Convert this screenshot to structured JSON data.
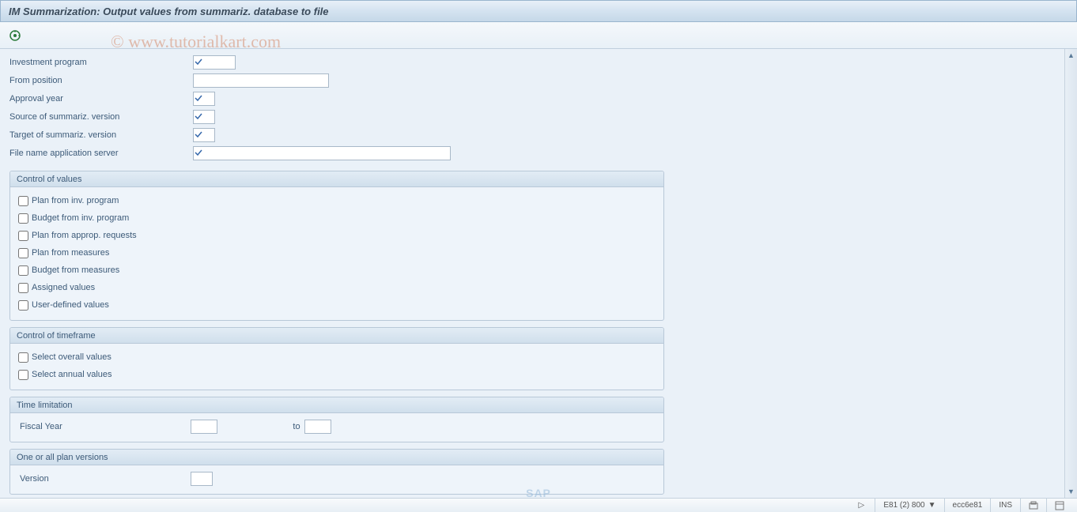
{
  "title": "IM Summarization: Output values from summariz. database to file",
  "watermark": "© www.tutorialkart.com",
  "header_fields": {
    "investment_program": {
      "label": "Investment program",
      "value": "",
      "required": true
    },
    "from_position": {
      "label": "From position",
      "value": "",
      "required": false
    },
    "approval_year": {
      "label": "Approval year",
      "value": "",
      "required": true
    },
    "source_version": {
      "label": "Source of summariz. version",
      "value": "",
      "required": true
    },
    "target_version": {
      "label": "Target of summariz. version",
      "value": "",
      "required": true
    },
    "file_name": {
      "label": "File name application server",
      "value": "",
      "required": true
    }
  },
  "groups": {
    "control_values": {
      "title": "Control of values",
      "items": [
        {
          "label": "Plan from inv. program",
          "checked": false
        },
        {
          "label": "Budget from inv. program",
          "checked": false
        },
        {
          "label": "Plan from approp. requests",
          "checked": false
        },
        {
          "label": "Plan from measures",
          "checked": false
        },
        {
          "label": "Budget from measures",
          "checked": false
        },
        {
          "label": "Assigned values",
          "checked": false
        },
        {
          "label": "User-defined values",
          "checked": false
        }
      ]
    },
    "control_timeframe": {
      "title": "Control of timeframe",
      "items": [
        {
          "label": "Select overall values",
          "checked": false
        },
        {
          "label": "Select annual values",
          "checked": false
        }
      ]
    },
    "time_limitation": {
      "title": "Time limitation",
      "fiscal_year_label": "Fiscal Year",
      "to_label": "to",
      "from": "",
      "to": ""
    },
    "plan_versions": {
      "title": "One or all plan versions",
      "version_label": "Version",
      "version": ""
    }
  },
  "status": {
    "system": "E81 (2) 800",
    "server": "ecc6e81",
    "mode": "INS"
  }
}
